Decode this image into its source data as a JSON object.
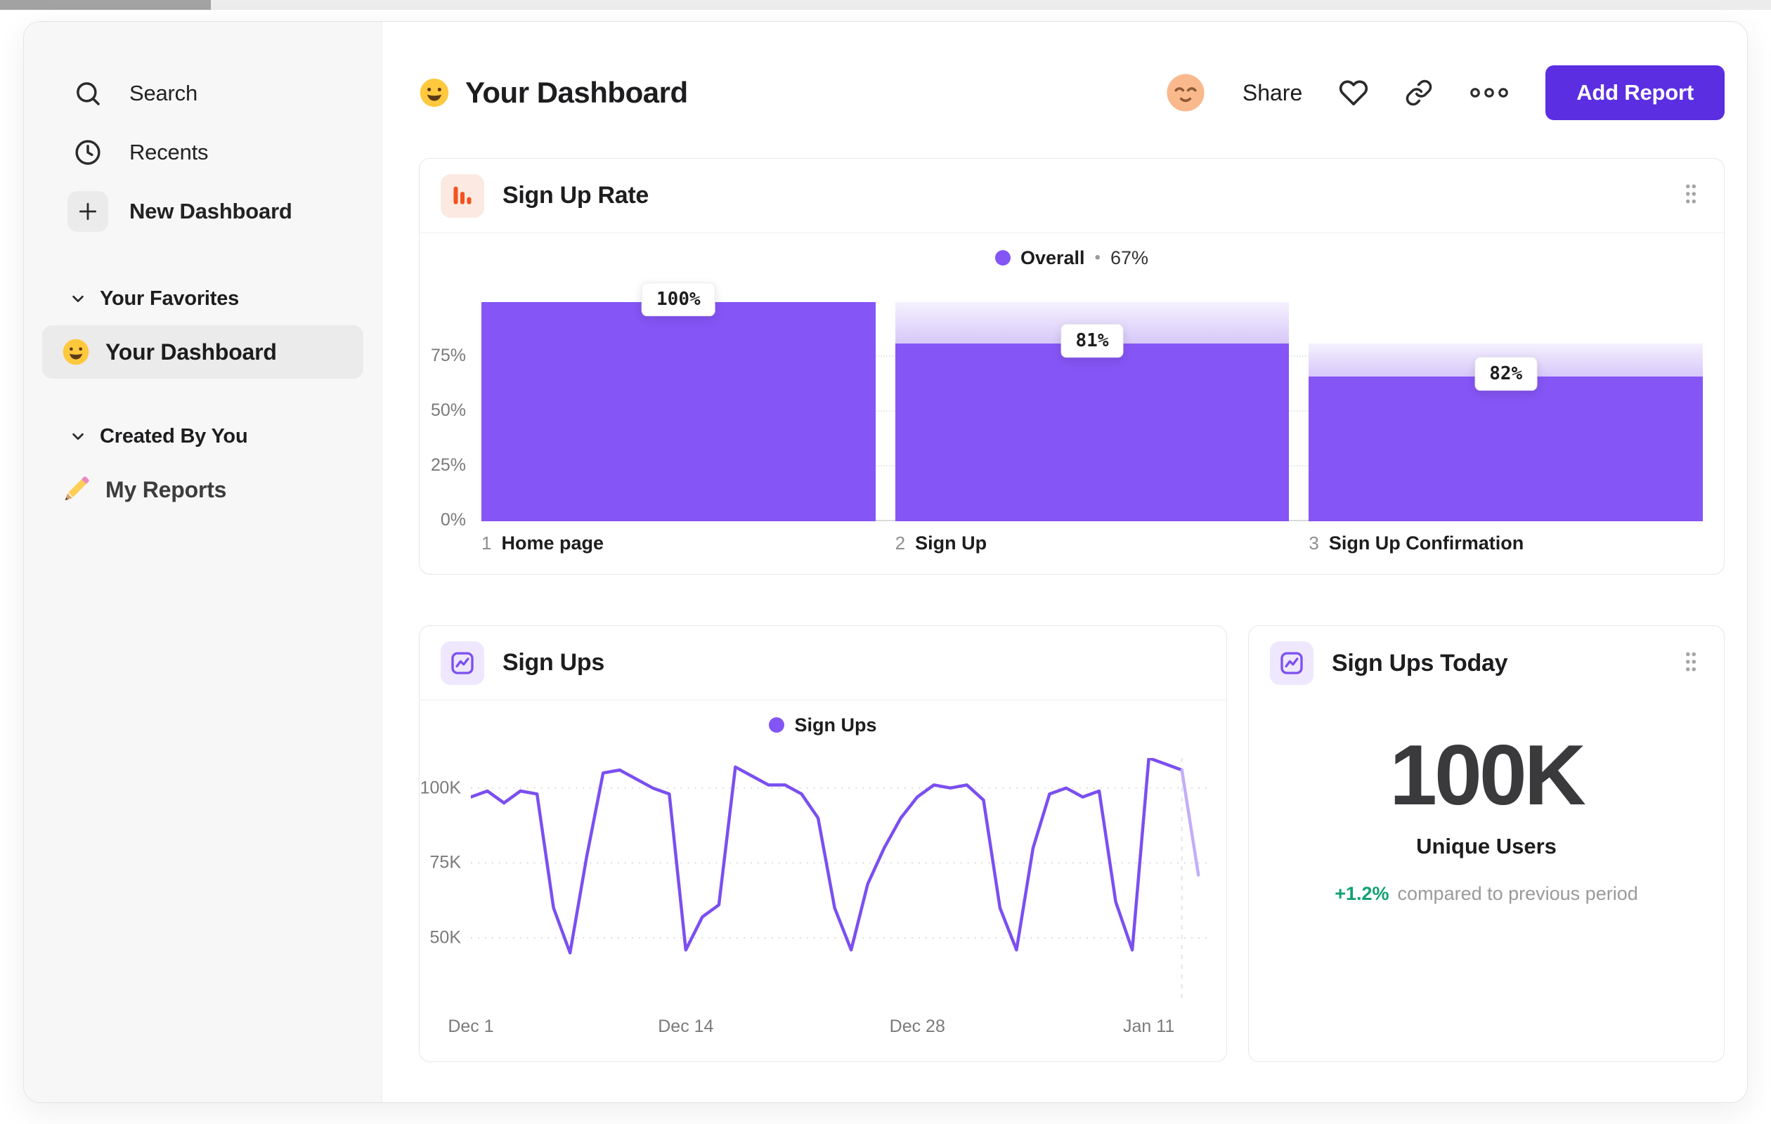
{
  "sidebar": {
    "top_items": [
      {
        "label": "Search",
        "icon": "search-icon"
      },
      {
        "label": "Recents",
        "icon": "clock-icon"
      },
      {
        "label": "New Dashboard",
        "icon": "plus-icon"
      }
    ],
    "sections": [
      {
        "header": "Your Favorites",
        "icon": "chevron-down-icon",
        "items": [
          {
            "label": "Your Dashboard",
            "icon": "smiley-emoji",
            "selected": true
          }
        ]
      },
      {
        "header": "Created By You",
        "icon": "chevron-down-icon",
        "items": [
          {
            "label": "My Reports",
            "icon": "pencil-emoji",
            "selected": false
          }
        ]
      }
    ]
  },
  "header": {
    "emoji": "smiley-emoji",
    "title": "Your Dashboard",
    "avatar": "relieved-face-avatar",
    "share_label": "Share",
    "icons": [
      "heart-icon",
      "link-icon",
      "ellipsis-icon"
    ],
    "add_report_label": "Add Report"
  },
  "colors": {
    "accent_purple": "#8355F5",
    "button_purple": "#5B2EE1",
    "funnel_orange": "#F4511E",
    "positive_green": "#12A172",
    "sidebar_bg": "#F7F7F7"
  },
  "chart_data": [
    {
      "type": "bar",
      "variant": "funnel",
      "title": "Sign Up Rate",
      "icon": "bar-chart-icon",
      "legend": {
        "label": "Overall",
        "separator": "•",
        "value": "67%"
      },
      "yticks": [
        "75%",
        "50%",
        "25%",
        "0%"
      ],
      "ytick_pcts": [
        75,
        50,
        25,
        0
      ],
      "categories": [
        "1 Home page",
        "2 Sign Up",
        "3 Sign Up Confirmation"
      ],
      "steps": [
        {
          "index": "1",
          "label": "Home page",
          "badge": "100%",
          "conversion_pct": 100,
          "absolute_pct": 100,
          "prev_absolute_pct": 100
        },
        {
          "index": "2",
          "label": "Sign Up",
          "badge": "81%",
          "conversion_pct": 81,
          "absolute_pct": 81,
          "prev_absolute_pct": 100
        },
        {
          "index": "3",
          "label": "Sign Up Confirmation",
          "badge": "82%",
          "conversion_pct": 82,
          "absolute_pct": 66,
          "prev_absolute_pct": 81
        }
      ]
    },
    {
      "type": "line",
      "title": "Sign Ups",
      "icon": "line-chart-icon",
      "legend": {
        "label": "Sign Ups"
      },
      "unit": "K",
      "ylim": [
        28,
        110
      ],
      "grid": "horizontal-dotted",
      "legend_position": "top-center",
      "yticks": [
        {
          "label": "100K",
          "value": 100
        },
        {
          "label": "75K",
          "value": 75
        },
        {
          "label": "50K",
          "value": 50
        }
      ],
      "xticks": [
        {
          "label": "Dec 1",
          "day": 0
        },
        {
          "label": "Dec 14",
          "day": 13
        },
        {
          "label": "Dec 28",
          "day": 27
        },
        {
          "label": "Jan 11",
          "day": 41
        }
      ],
      "x_domain_days": [
        0,
        44.5
      ],
      "dim_from_day": 43,
      "series": [
        {
          "name": "Sign Ups",
          "points": [
            [
              0,
              97
            ],
            [
              1,
              99
            ],
            [
              2,
              95
            ],
            [
              3,
              99
            ],
            [
              4,
              98
            ],
            [
              5,
              60
            ],
            [
              6,
              45
            ],
            [
              7,
              77
            ],
            [
              8,
              105
            ],
            [
              9,
              106
            ],
            [
              10,
              103
            ],
            [
              11,
              100
            ],
            [
              12,
              98
            ],
            [
              13,
              46
            ],
            [
              14,
              57
            ],
            [
              15,
              61
            ],
            [
              16,
              107
            ],
            [
              17,
              104
            ],
            [
              18,
              101
            ],
            [
              19,
              101
            ],
            [
              20,
              98
            ],
            [
              21,
              90
            ],
            [
              22,
              60
            ],
            [
              23,
              46
            ],
            [
              24,
              68
            ],
            [
              25,
              80
            ],
            [
              26,
              90
            ],
            [
              27,
              97
            ],
            [
              28,
              101
            ],
            [
              29,
              100
            ],
            [
              30,
              101
            ],
            [
              31,
              96
            ],
            [
              32,
              60
            ],
            [
              33,
              46
            ],
            [
              34,
              80
            ],
            [
              35,
              98
            ],
            [
              36,
              100
            ],
            [
              37,
              97
            ],
            [
              38,
              99
            ],
            [
              39,
              62
            ],
            [
              40,
              46
            ],
            [
              41,
              110
            ],
            [
              42,
              108
            ],
            [
              43,
              106
            ],
            [
              44,
              71
            ]
          ]
        }
      ]
    },
    {
      "type": "stat",
      "title": "Sign Ups Today",
      "icon": "line-chart-icon",
      "value": "100K",
      "caption": "Unique Users",
      "delta": "+1.2%",
      "delta_caption": "compared to previous period"
    }
  ]
}
